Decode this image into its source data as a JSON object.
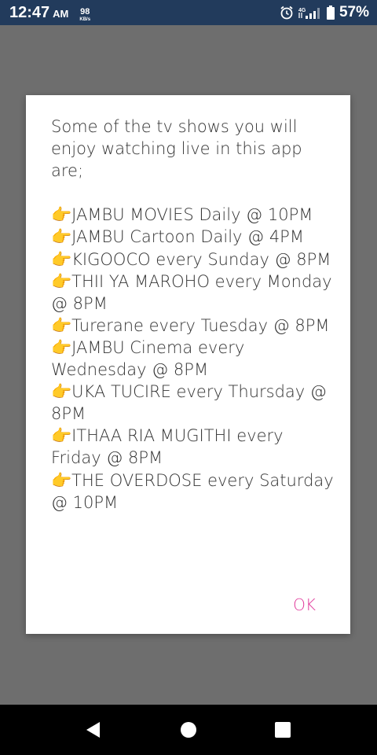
{
  "status_bar": {
    "time": "12:47",
    "ampm": "AM",
    "net_speed": "98",
    "net_unit": "KB/s",
    "battery": "57%",
    "network_type": "4G",
    "icons": [
      "alarm-icon",
      "signal-icon",
      "battery-icon"
    ]
  },
  "dialog": {
    "message": "Some of the tv shows you will enjoy watching live in this app are;\n\n👉JAMBU MOVIES Daily @ 10PM\n👉JAMBU Cartoon Daily @ 4PM\n👉KIGOOCO every Sunday @ 8PM\n👉THII YA MAROHO every Monday @ 8PM\n👉Turerane every Tuesday @ 8PM\n👉JAMBU Cinema every Wednesday @ 8PM\n👉UKA TUCIRE every Thursday @ 8PM\n👉ITHAA RIA MUGITHI every Friday @ 8PM\n👉THE OVERDOSE every Saturday @ 10PM",
    "ok_label": "OK",
    "accent_color": "#e0389a"
  },
  "nav_bar": {
    "buttons": [
      "back-icon",
      "home-icon",
      "recents-icon"
    ]
  }
}
